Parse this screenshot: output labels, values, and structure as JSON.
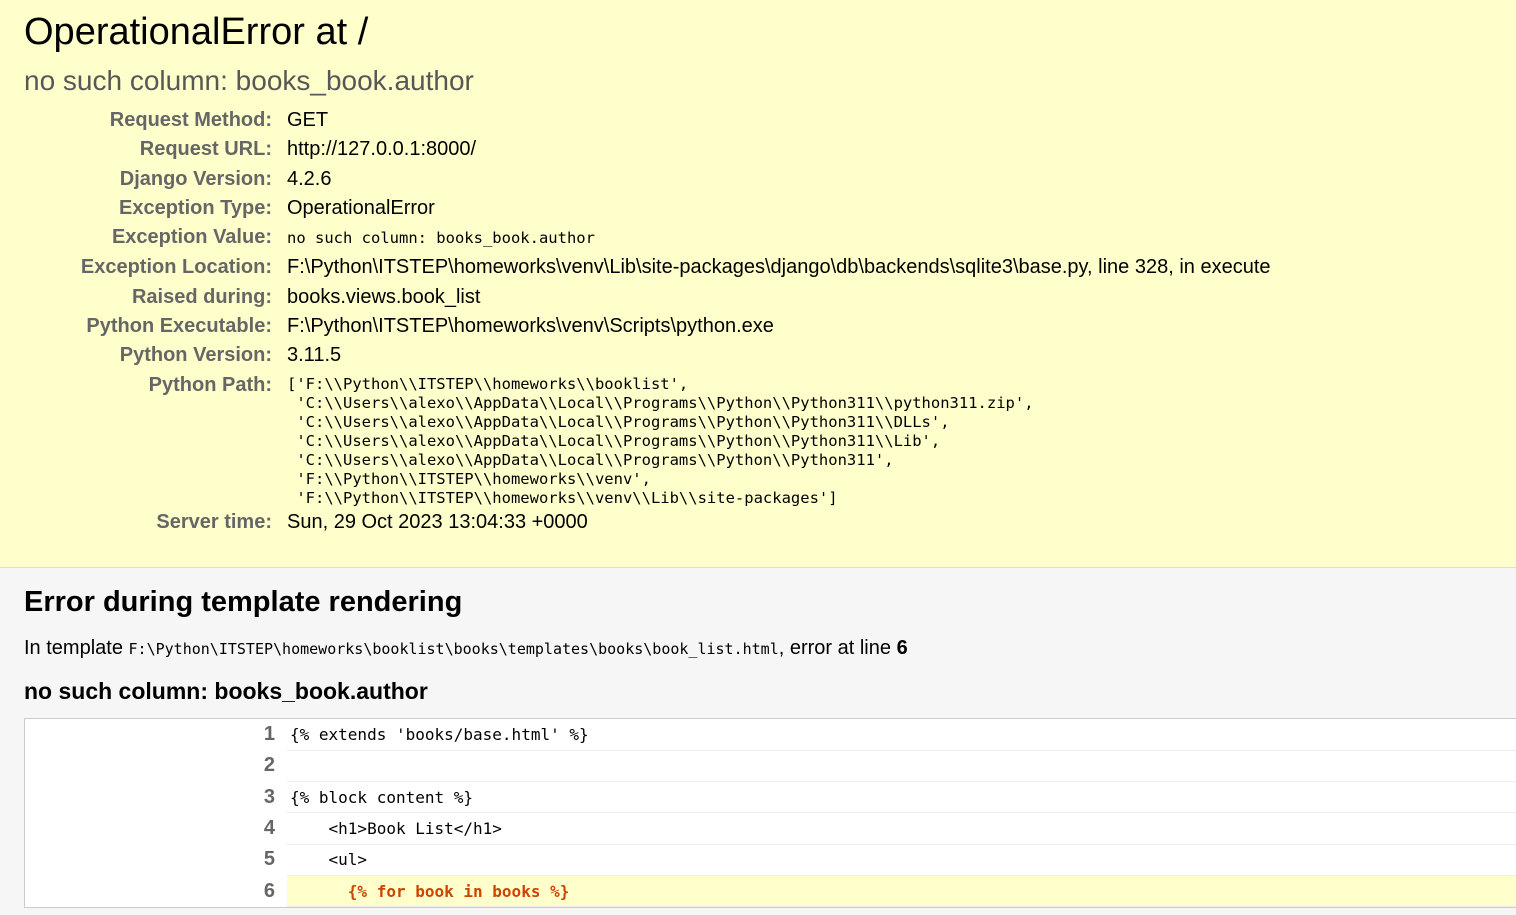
{
  "summary": {
    "title": "OperationalError at /",
    "subtitle": "no such column: books_book.author",
    "rows": [
      {
        "label": "Request Method:",
        "value": "GET"
      },
      {
        "label": "Request URL:",
        "value": "http://127.0.0.1:8000/"
      },
      {
        "label": "Django Version:",
        "value": "4.2.6"
      },
      {
        "label": "Exception Type:",
        "value": "OperationalError"
      },
      {
        "label": "Exception Value:",
        "value": "no such column: books_book.author"
      },
      {
        "label": "Exception Location:",
        "value": "F:\\Python\\ITSTEP\\homeworks\\venv\\Lib\\site-packages\\django\\db\\backends\\sqlite3\\base.py, line 328, in execute"
      },
      {
        "label": "Raised during:",
        "value": "books.views.book_list"
      },
      {
        "label": "Python Executable:",
        "value": "F:\\Python\\ITSTEP\\homeworks\\venv\\Scripts\\python.exe"
      },
      {
        "label": "Python Version:",
        "value": "3.11.5"
      },
      {
        "label": "Python Path:",
        "value": "['F:\\\\Python\\\\ITSTEP\\\\homeworks\\\\booklist',\n 'C:\\\\Users\\\\alexo\\\\AppData\\\\Local\\\\Programs\\\\Python\\\\Python311\\\\python311.zip',\n 'C:\\\\Users\\\\alexo\\\\AppData\\\\Local\\\\Programs\\\\Python\\\\Python311\\\\DLLs',\n 'C:\\\\Users\\\\alexo\\\\AppData\\\\Local\\\\Programs\\\\Python\\\\Python311\\\\Lib',\n 'C:\\\\Users\\\\alexo\\\\AppData\\\\Local\\\\Programs\\\\Python\\\\Python311',\n 'F:\\\\Python\\\\ITSTEP\\\\homeworks\\\\venv',\n 'F:\\\\Python\\\\ITSTEP\\\\homeworks\\\\venv\\\\Lib\\\\site-packages']"
      },
      {
        "label": "Server time:",
        "value": "Sun, 29 Oct 2023 13:04:33 +0000"
      }
    ]
  },
  "template": {
    "heading": "Error during template rendering",
    "intro_prefix": "In template ",
    "path": "F:\\Python\\ITSTEP\\homeworks\\booklist\\books\\templates\\books\\book_list.html",
    "intro_middle": ", error at line ",
    "error_line": "6",
    "error_message": "no such column: books_book.author",
    "lines": [
      {
        "num": "1",
        "code": "{% extends 'books/base.html' %}"
      },
      {
        "num": "2",
        "code": ""
      },
      {
        "num": "3",
        "code": "{% block content %}"
      },
      {
        "num": "4",
        "code": "    <h1>Book List</h1>"
      },
      {
        "num": "5",
        "code": "    <ul>"
      },
      {
        "num": "6",
        "code": "      {% for book in books %}"
      }
    ]
  }
}
